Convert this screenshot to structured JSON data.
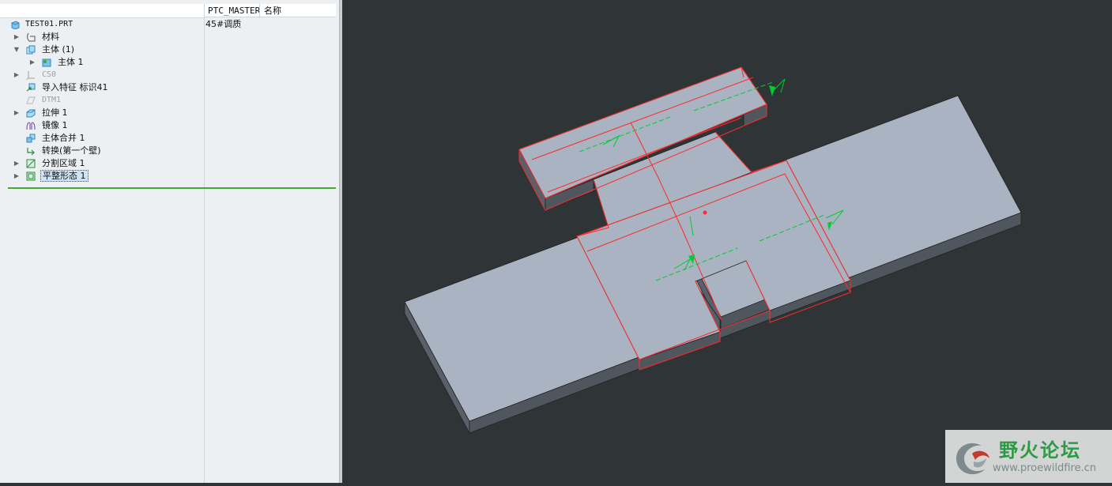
{
  "tree": {
    "col_master": "PTC_MASTER",
    "col_name": "名称",
    "master_value": "45#调质",
    "items": [
      {
        "label": "TEST01.PRT",
        "icon": "part-icon"
      },
      {
        "label": "材料",
        "icon": "material-icon"
      },
      {
        "label": "主体 (1)",
        "icon": "body-group-icon"
      },
      {
        "label": "主体 1",
        "icon": "body-icon"
      },
      {
        "label": "CS0",
        "icon": "csys-icon"
      },
      {
        "label": "导入特征 标识41",
        "icon": "import-feature-icon"
      },
      {
        "label": "DTM1",
        "icon": "datum-plane-icon"
      },
      {
        "label": "拉伸 1",
        "icon": "extrude-icon"
      },
      {
        "label": "镜像 1",
        "icon": "mirror-icon"
      },
      {
        "label": "主体合并 1",
        "icon": "body-merge-icon"
      },
      {
        "label": "转换(第一个壁)",
        "icon": "convert-icon"
      },
      {
        "label": "分割区域 1",
        "icon": "split-area-icon"
      },
      {
        "label": "平整形态 1",
        "icon": "flat-state-icon"
      }
    ]
  },
  "colors": {
    "viewport_bg": "#2f3436",
    "model_face": "#a9b3c1",
    "model_side": "#5a6069",
    "highlight_edge": "#ff2a2a",
    "annotation": "#00cc33",
    "insert_line": "#44aa33"
  },
  "watermark": {
    "title": "野火论坛",
    "url": "www.proewildfire.cn"
  }
}
